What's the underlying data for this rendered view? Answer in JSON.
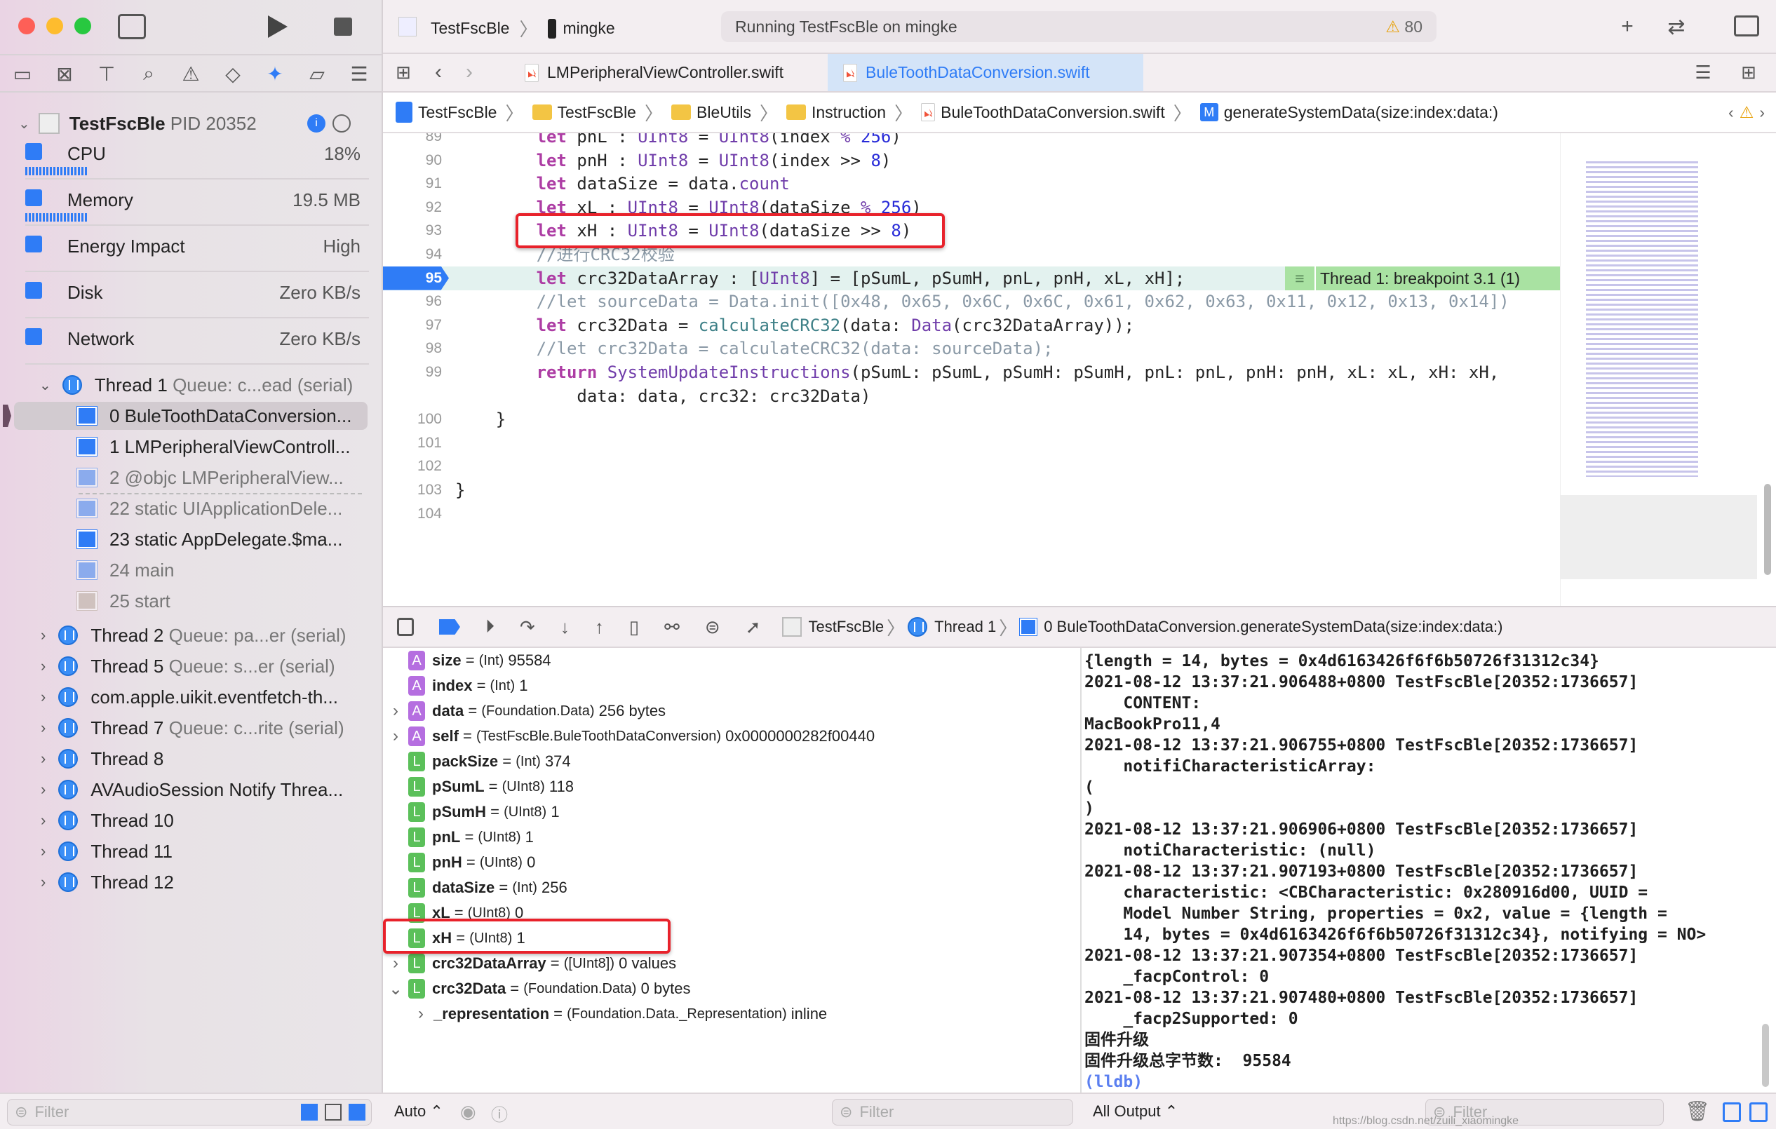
{
  "toolbar": {
    "scheme": "TestFscBle",
    "device": "mingke",
    "status": "Running TestFscBle on mingke",
    "warnings": "80"
  },
  "tabs": [
    {
      "label": "LMPeripheralViewController.swift",
      "active": false
    },
    {
      "label": "BuleToothDataConversion.swift",
      "active": true
    }
  ],
  "breadcrumb": [
    "TestFscBle",
    "TestFscBle",
    "BleUtils",
    "Instruction",
    "BuleToothDataConversion.swift",
    "generateSystemData(size:index:data:)"
  ],
  "sidebar": {
    "process": {
      "name": "TestFscBle",
      "pid": "PID 20352"
    },
    "gauges": [
      {
        "label": "CPU",
        "value": "18%"
      },
      {
        "label": "Memory",
        "value": "19.5 MB"
      },
      {
        "label": "Energy Impact",
        "value": "High"
      },
      {
        "label": "Disk",
        "value": "Zero KB/s"
      },
      {
        "label": "Network",
        "value": "Zero KB/s"
      }
    ],
    "thread1": {
      "name": "Thread 1",
      "queue": "Queue: c...ead (serial)"
    },
    "frames": [
      {
        "label": "0 BuleToothDataConversion...",
        "dim": false,
        "selected": true
      },
      {
        "label": "1 LMPeripheralViewControll...",
        "dim": false
      },
      {
        "label": "2 @objc LMPeripheralView...",
        "dim": true
      },
      {
        "label": "22 static UIApplicationDele...",
        "dim": true
      },
      {
        "label": "23 static AppDelegate.$ma...",
        "dim": false
      },
      {
        "label": "24 main",
        "dim": true
      },
      {
        "label": "25 start",
        "dim": true,
        "system": true
      }
    ],
    "threads": [
      {
        "name": "Thread 2",
        "queue": "Queue: pa...er (serial)"
      },
      {
        "name": "Thread 5",
        "queue": "Queue: s...er (serial)"
      },
      {
        "name": "com.apple.uikit.eventfetch-th...",
        "queue": ""
      },
      {
        "name": "Thread 7",
        "queue": "Queue: c...rite (serial)"
      },
      {
        "name": "Thread 8",
        "queue": ""
      },
      {
        "name": "AVAudioSession Notify Threa...",
        "queue": ""
      },
      {
        "name": "Thread 10",
        "queue": ""
      },
      {
        "name": "Thread 11",
        "queue": ""
      },
      {
        "name": "Thread 12",
        "queue": ""
      }
    ],
    "filter_placeholder": "Filter"
  },
  "editor": {
    "lines": [
      {
        "n": "89",
        "code": "        let pnL : UInt8 = UInt8(index % 256)"
      },
      {
        "n": "90",
        "code": "        let pnH : UInt8 = UInt8(index >> 8)"
      },
      {
        "n": "91",
        "code": "        let dataSize = data.count"
      },
      {
        "n": "92",
        "code": "        let xL : UInt8 = UInt8(dataSize % 256)"
      },
      {
        "n": "93",
        "code": "        let xH : UInt8 = UInt8(dataSize >> 8)"
      },
      {
        "n": "94",
        "code": "        //进行CRC32校验"
      },
      {
        "n": "95",
        "code": "        let crc32DataArray : [UInt8] = [pSumL, pSumH, pnL, pnH, xL, xH];"
      },
      {
        "n": "96",
        "code": "        //let sourceData = Data.init([0x48, 0x65, 0x6C, 0x6C, 0x61, 0x62, 0x63, 0x11, 0x12, 0x13, 0x14])"
      },
      {
        "n": "97",
        "code": "        let crc32Data = calculateCRC32(data: Data(crc32DataArray));"
      },
      {
        "n": "98",
        "code": "        //let crc32Data = calculateCRC32(data: sourceData);"
      },
      {
        "n": "99",
        "code": "        return SystemUpdateInstructions(pSumL: pSumL, pSumH: pSumH, pnL: pnL, pnH: pnH, xL: xL, xH: xH,"
      },
      {
        "n": "",
        "code": "            data: data, crc32: crc32Data)"
      },
      {
        "n": "100",
        "code": "    }"
      },
      {
        "n": "101",
        "code": ""
      },
      {
        "n": "102",
        "code": ""
      },
      {
        "n": "103",
        "code": "}"
      },
      {
        "n": "104",
        "code": ""
      }
    ],
    "current_line": "95",
    "breakpoint_label": "Thread 1: breakpoint 3.1 (1)"
  },
  "debugbar": {
    "crumbs": [
      "TestFscBle",
      "Thread 1",
      "0 BuleToothDataConversion.generateSystemData(size:index:data:)"
    ]
  },
  "variables": [
    {
      "kind": "A",
      "name": "size",
      "type": "(Int)",
      "value": "95584",
      "expand": ""
    },
    {
      "kind": "A",
      "name": "index",
      "type": "(Int)",
      "value": "1",
      "expand": ""
    },
    {
      "kind": "A",
      "name": "data",
      "type": "(Foundation.Data)",
      "value": "256 bytes",
      "expand": "collapsed"
    },
    {
      "kind": "A",
      "name": "self",
      "type": "(TestFscBle.BuleToothDataConversion)",
      "value": "0x0000000282f00440",
      "expand": "collapsed"
    },
    {
      "kind": "L",
      "name": "packSize",
      "type": "(Int)",
      "value": "374",
      "expand": ""
    },
    {
      "kind": "L",
      "name": "pSumL",
      "type": "(UInt8)",
      "value": "118",
      "expand": ""
    },
    {
      "kind": "L",
      "name": "pSumH",
      "type": "(UInt8)",
      "value": "1",
      "expand": ""
    },
    {
      "kind": "L",
      "name": "pnL",
      "type": "(UInt8)",
      "value": "1",
      "expand": ""
    },
    {
      "kind": "L",
      "name": "pnH",
      "type": "(UInt8)",
      "value": "0",
      "expand": ""
    },
    {
      "kind": "L",
      "name": "dataSize",
      "type": "(Int)",
      "value": "256",
      "expand": ""
    },
    {
      "kind": "L",
      "name": "xL",
      "type": "(UInt8)",
      "value": "0",
      "expand": ""
    },
    {
      "kind": "L",
      "name": "xH",
      "type": "(UInt8)",
      "value": "1",
      "expand": ""
    },
    {
      "kind": "L",
      "name": "crc32DataArray",
      "type": "([UInt8])",
      "value": "0 values",
      "expand": "collapsed"
    },
    {
      "kind": "L",
      "name": "crc32Data",
      "type": "(Foundation.Data)",
      "value": "0 bytes",
      "expand": "expanded"
    },
    {
      "kind": "",
      "name": "_representation",
      "type": "(Foundation.Data._Representation)",
      "value": "inline",
      "expand": "collapsed",
      "child": true
    }
  ],
  "console": {
    "lines": [
      "{length = 14, bytes = 0x4d6163426f6f6b50726f31312c34}",
      "2021-08-12 13:37:21.906488+0800 TestFscBle[20352:1736657]",
      "    CONTENT:",
      "MacBookPro11,4",
      "2021-08-12 13:37:21.906755+0800 TestFscBle[20352:1736657]",
      "    notifiCharacteristicArray:",
      "(",
      ")",
      "2021-08-12 13:37:21.906906+0800 TestFscBle[20352:1736657]",
      "    notiCharacteristic: (null)",
      "2021-08-12 13:37:21.907193+0800 TestFscBle[20352:1736657]",
      "    characteristic: <CBCharacteristic: 0x280916d00, UUID =",
      "    Model Number String, properties = 0x2, value = {length =",
      "    14, bytes = 0x4d6163426f6f6b50726f31312c34}, notifying = NO>",
      "2021-08-12 13:37:21.907354+0800 TestFscBle[20352:1736657]",
      "    _facpControl: 0",
      "2021-08-12 13:37:21.907480+0800 TestFscBle[20352:1736657]",
      "    _facp2Supported: 0",
      "固件升级",
      "固件升级总字节数:  95584"
    ],
    "prompt": "(lldb)"
  },
  "bottom": {
    "auto": "Auto ⌃",
    "var_filter": "Filter",
    "output": "All Output ⌃",
    "console_filter": "Filter",
    "watermark": "https://blog.csdn.net/zuili_xiaomingke"
  },
  "colors": {
    "accent": "#2f7cf6",
    "highlight": "#e8222b",
    "breakpoint_bg": "#a9e2a2",
    "arg_badge": "#b56ee0",
    "local_badge": "#5bc05a"
  }
}
